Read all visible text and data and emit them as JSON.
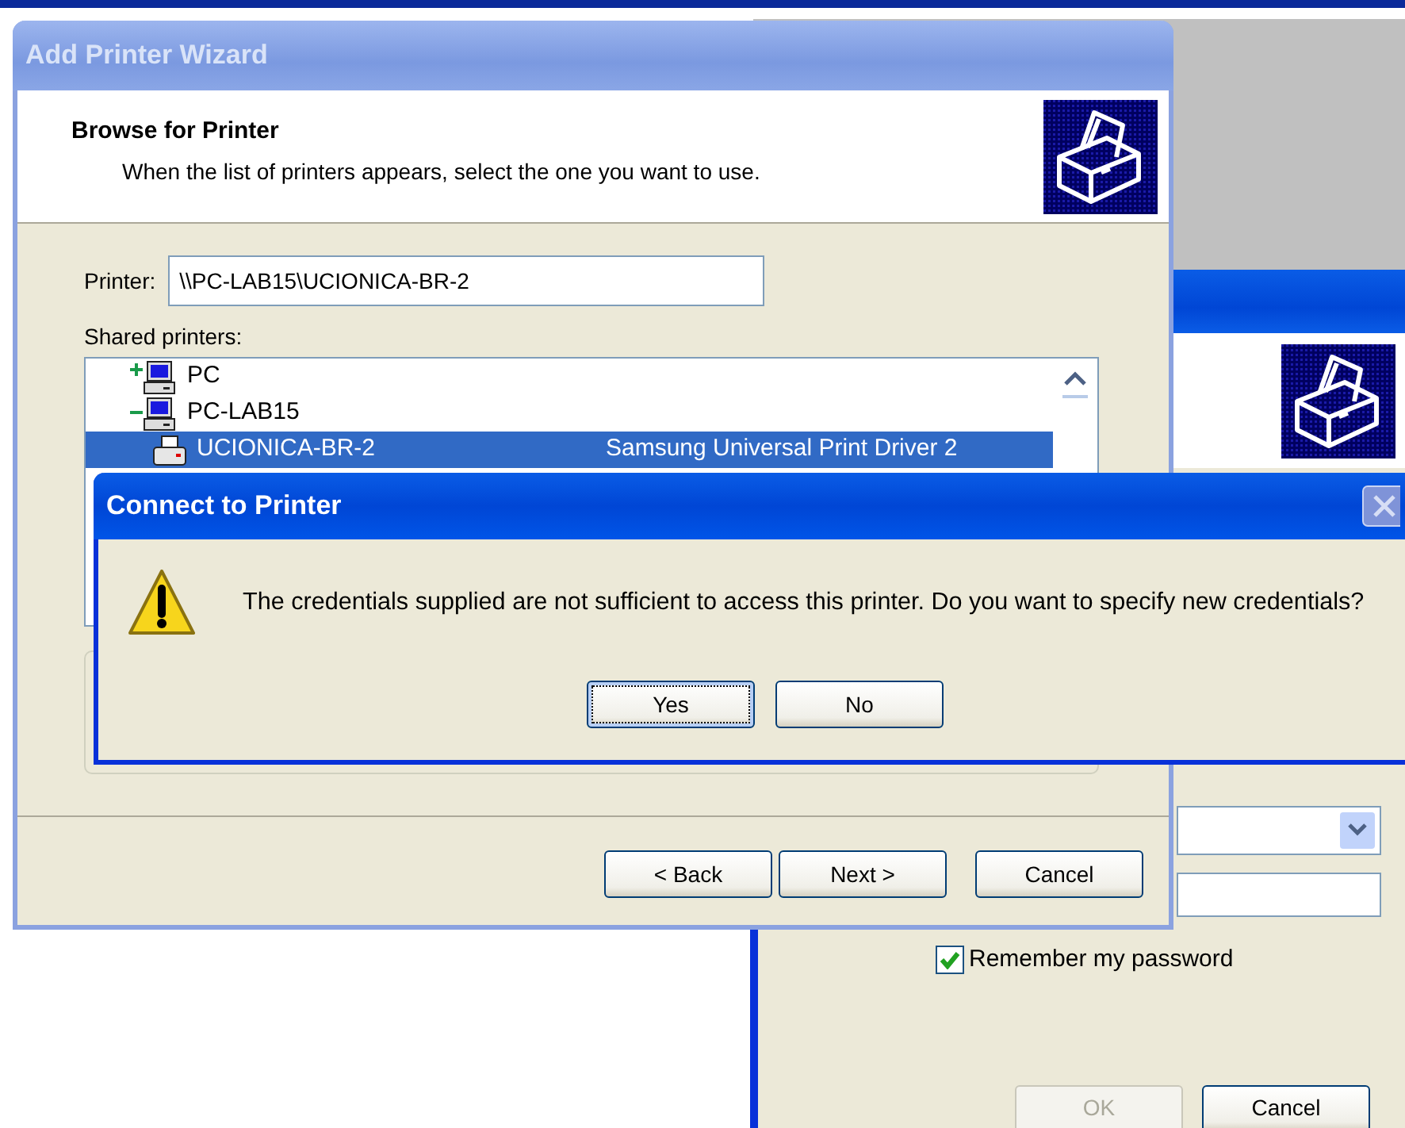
{
  "credentials_window": {
    "remember_password": {
      "label": "Remember my password",
      "checked": true
    },
    "buttons": [
      {
        "label": "OK",
        "disabled": true
      },
      {
        "label": "Cancel",
        "disabled": false
      }
    ]
  },
  "add_printer_wizard": {
    "title": "Add Printer Wizard",
    "active": false,
    "header": {
      "title": "Browse for Printer",
      "subtitle": "When the list of printers appears, select the one you want to use."
    },
    "printer_label": "Printer:",
    "printer_value": "\\\\PC-LAB15\\UCIONICA-BR-2",
    "shared_label": "Shared printers:",
    "tree": [
      {
        "label": "PC",
        "expanded": false
      },
      {
        "label": "PC-LAB15",
        "expanded": true,
        "children": [
          {
            "label": "UCIONICA-BR-2",
            "driver": "Samsung Universal Print Driver 2",
            "selected": true
          }
        ]
      }
    ],
    "buttons": [
      {
        "label": "< Back"
      },
      {
        "label": "Next >"
      },
      {
        "label": "Cancel"
      }
    ]
  },
  "connect_dialog": {
    "title": "Connect to Printer",
    "message": "The credentials supplied are not sufficient to access this printer. Do you want to specify new credentials?",
    "buttons": [
      {
        "label": "Yes",
        "focused": true
      },
      {
        "label": "No",
        "focused": false
      }
    ]
  }
}
